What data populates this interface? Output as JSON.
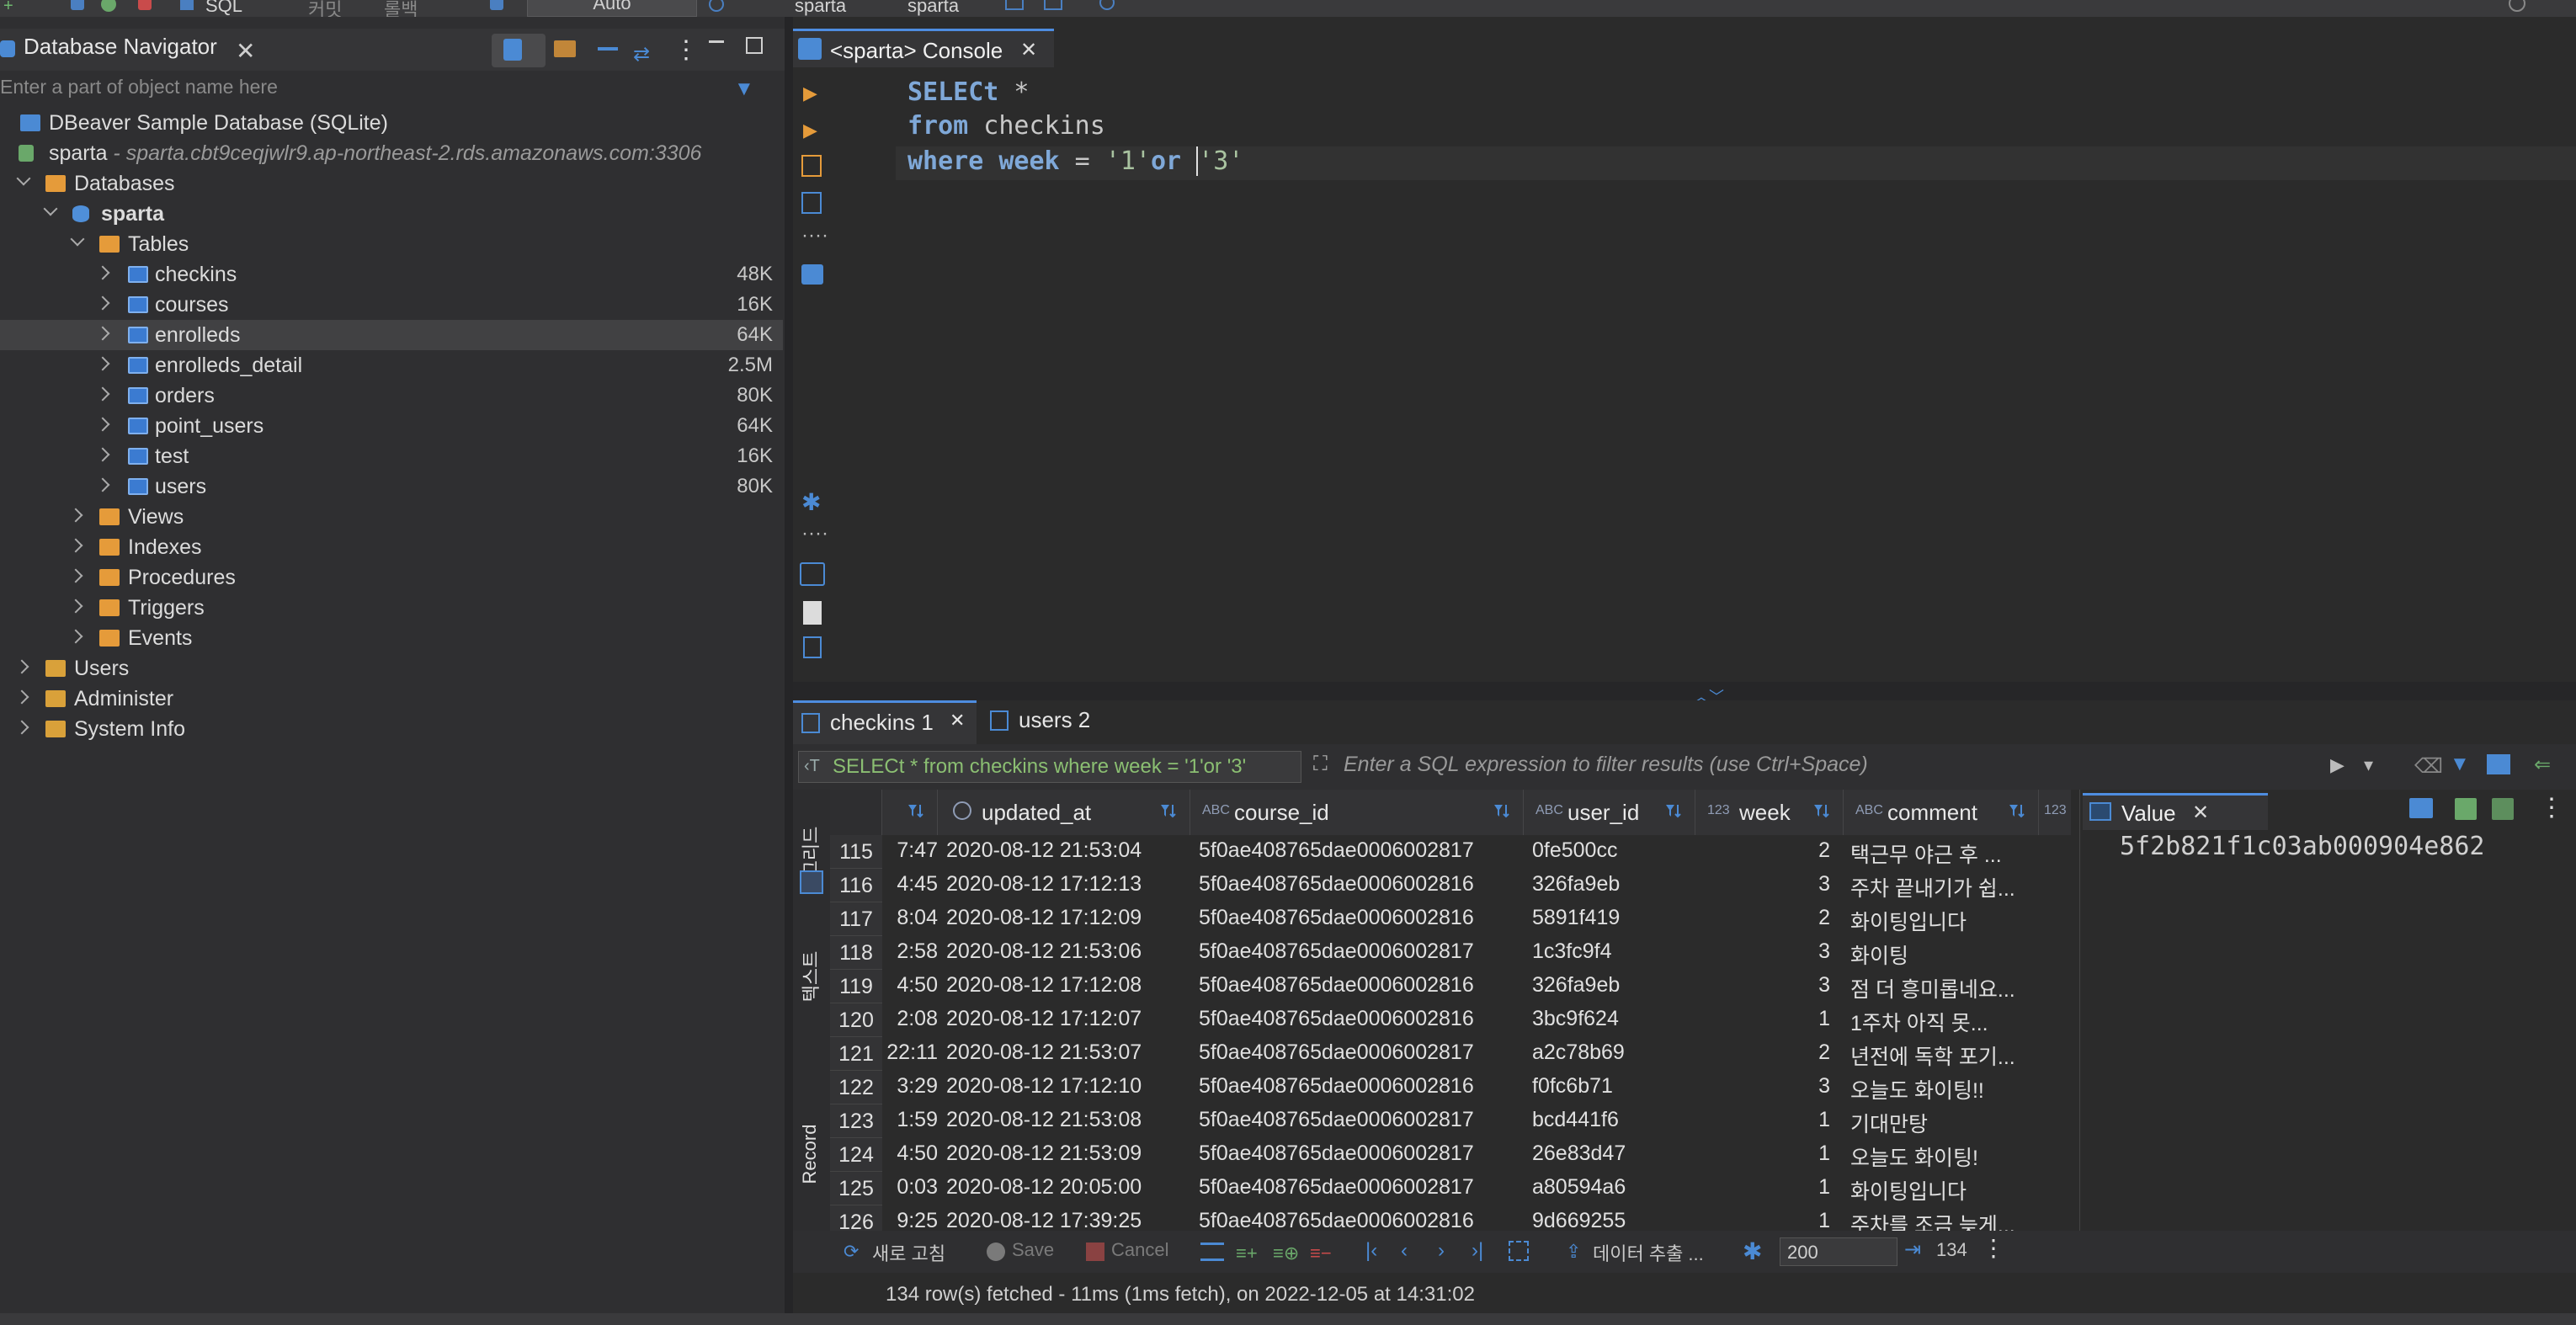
{
  "toolbar": {
    "sql_label": "SQL",
    "commit_label": "커밋",
    "rollback_label": "롤백",
    "tx_mode": "Auto",
    "datasource": "sparta",
    "schema": "sparta"
  },
  "navigator": {
    "title": "Database Navigator",
    "filter_placeholder": "Enter a part of object name here",
    "tree": {
      "sqlite_db": "DBeaver Sample Database (SQLite)",
      "sparta_conn": "sparta",
      "sparta_host": " - sparta.cbt9ceqjwlr9.ap-northeast-2.rds.amazonaws.com:3306",
      "databases": "Databases",
      "schema": "sparta",
      "tables_label": "Tables",
      "tables": [
        {
          "name": "checkins",
          "size": "48K"
        },
        {
          "name": "courses",
          "size": "16K"
        },
        {
          "name": "enrolleds",
          "size": "64K"
        },
        {
          "name": "enrolleds_detail",
          "size": "2.5M"
        },
        {
          "name": "orders",
          "size": "80K"
        },
        {
          "name": "point_users",
          "size": "64K"
        },
        {
          "name": "test",
          "size": "16K"
        },
        {
          "name": "users",
          "size": "80K"
        }
      ],
      "views": "Views",
      "indexes": "Indexes",
      "procedures": "Procedures",
      "triggers": "Triggers",
      "events": "Events",
      "users": "Users",
      "administer": "Administer",
      "system_info": "System Info"
    }
  },
  "editor": {
    "tab_title": "<sparta> Console",
    "line1_kw": "SELECt",
    "line1_rest": " *",
    "line2_kw": "from",
    "line2_rest": " checkins",
    "line3_kw": "where",
    "line3_col": " week",
    "line3_eq": " = ",
    "line3_s1": "'1'",
    "line3_or": "or",
    "line3_sp": " ",
    "line3_s2": "'3'"
  },
  "results": {
    "tab1": "checkins 1",
    "tab2": "users 2",
    "query_chip": "SELECt * from checkins where week = '1'or '3'",
    "filter_placeholder": "Enter a SQL expression to filter results (use Ctrl+Space)",
    "side_grid": "그리드",
    "side_text": "텍스트",
    "side_record": "Record",
    "columns": [
      {
        "name": "updated_at",
        "type": ""
      },
      {
        "name": "course_id",
        "type": "ABC"
      },
      {
        "name": "user_id",
        "type": "ABC"
      },
      {
        "name": "week",
        "type": "123"
      },
      {
        "name": "comment",
        "type": "ABC"
      }
    ],
    "rows": [
      {
        "n": "115",
        "prev": "7:47",
        "updated_at": "2020-08-12 21:53:04",
        "course_id": "5f0ae408765dae0006002817",
        "user_id": "0fe500cc",
        "week": "2",
        "comment": "택근무 야근 후 ..."
      },
      {
        "n": "116",
        "prev": "4:45",
        "updated_at": "2020-08-12 17:12:13",
        "course_id": "5f0ae408765dae0006002816",
        "user_id": "326fa9eb",
        "week": "3",
        "comment": "주차 끝내기가 쉽..."
      },
      {
        "n": "117",
        "prev": "8:04",
        "updated_at": "2020-08-12 17:12:09",
        "course_id": "5f0ae408765dae0006002816",
        "user_id": "5891f419",
        "week": "2",
        "comment": "화이팅입니다"
      },
      {
        "n": "118",
        "prev": "2:58",
        "updated_at": "2020-08-12 21:53:06",
        "course_id": "5f0ae408765dae0006002817",
        "user_id": "1c3fc9f4",
        "week": "3",
        "comment": "화이팅"
      },
      {
        "n": "119",
        "prev": "4:50",
        "updated_at": "2020-08-12 17:12:08",
        "course_id": "5f0ae408765dae0006002816",
        "user_id": "326fa9eb",
        "week": "3",
        "comment": "점 더 흥미롭네요..."
      },
      {
        "n": "120",
        "prev": "2:08",
        "updated_at": "2020-08-12 17:12:07",
        "course_id": "5f0ae408765dae0006002816",
        "user_id": "3bc9f624",
        "week": "1",
        "comment": " 1주차 아직 못..."
      },
      {
        "n": "121",
        "prev": "22:11",
        "updated_at": "2020-08-12 21:53:07",
        "course_id": "5f0ae408765dae0006002817",
        "user_id": "a2c78b69",
        "week": "2",
        "comment": "년전에 독학 포기..."
      },
      {
        "n": "122",
        "prev": "3:29",
        "updated_at": "2020-08-12 17:12:10",
        "course_id": "5f0ae408765dae0006002816",
        "user_id": "f0fc6b71",
        "week": "3",
        "comment": "오늘도 화이팅!!"
      },
      {
        "n": "123",
        "prev": "1:59",
        "updated_at": "2020-08-12 21:53:08",
        "course_id": "5f0ae408765dae0006002817",
        "user_id": "bcd441f6",
        "week": "1",
        "comment": "기대만탕"
      },
      {
        "n": "124",
        "prev": "4:50",
        "updated_at": "2020-08-12 21:53:09",
        "course_id": "5f0ae408765dae0006002817",
        "user_id": "26e83d47",
        "week": "1",
        "comment": "오늘도 화이팅!"
      },
      {
        "n": "125",
        "prev": "0:03",
        "updated_at": "2020-08-12 20:05:00",
        "course_id": "5f0ae408765dae0006002817",
        "user_id": "a80594a6",
        "week": "1",
        "comment": "화이팅입니다"
      },
      {
        "n": "126",
        "prev": "9:25",
        "updated_at": "2020-08-12 17:39:25",
        "course_id": "5f0ae408765dae0006002816",
        "user_id": "9d669255",
        "week": "1",
        "comment": "주차를 조금 늦게..."
      }
    ],
    "value_panel_title": "Value",
    "value_panel_value": "5f2b821f1c03ab000904e862",
    "bottom": {
      "refresh": "새로 고침",
      "save": "Save",
      "cancel": "Cancel",
      "export": "데이터 추출 ...",
      "fetch_size": "200",
      "row_count": "134"
    },
    "status": "134 row(s) fetched - 11ms (1ms fetch), on 2022-12-05 at 14:31:02"
  },
  "colors": {
    "accent": "#4e8de0",
    "keyword": "#7fa8d8",
    "string": "#a9c3a0",
    "query_chip_text": "#8bbf72"
  }
}
